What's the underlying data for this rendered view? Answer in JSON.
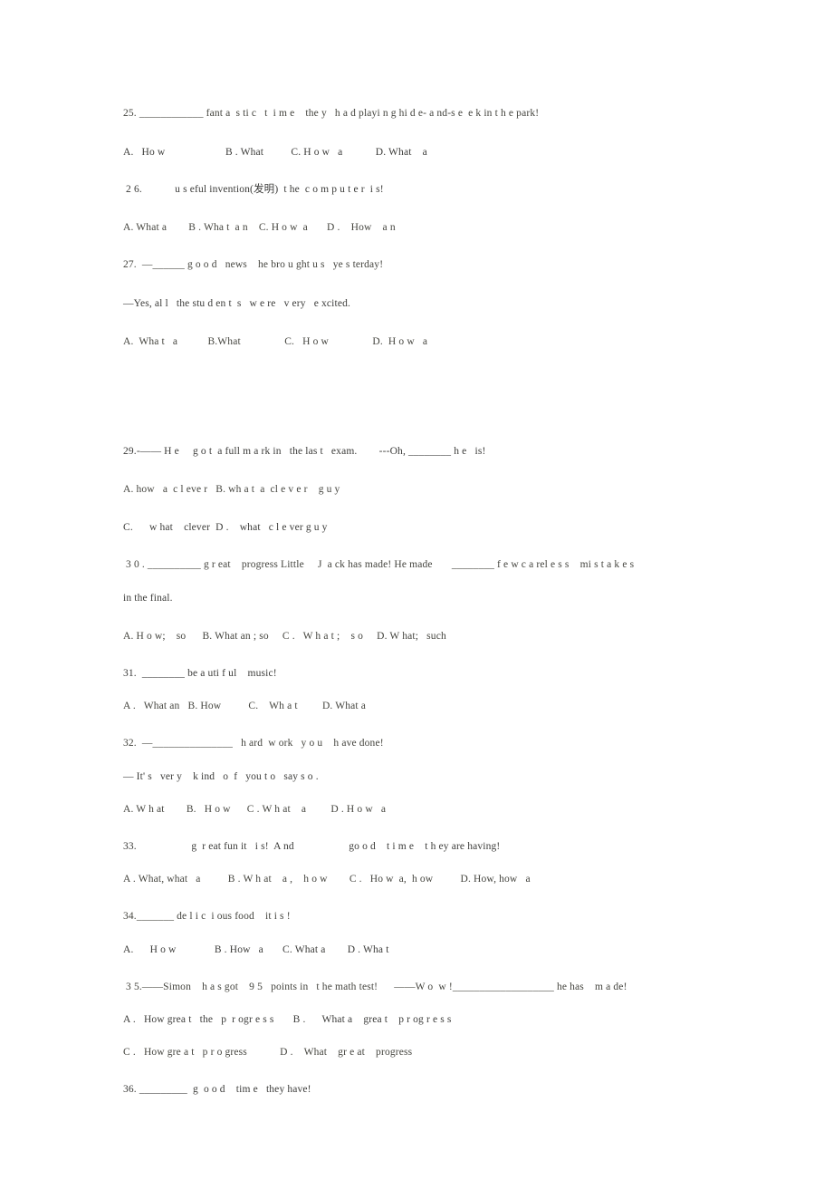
{
  "document": {
    "kind": "scanned-worksheet",
    "background_color": "#ffffff",
    "text_color": "#41413f"
  },
  "questions": [
    {
      "number": "25.",
      "stem": "25. ____________ fant a  s ti c   t  i m e    the y   h a d playi n g hi d e- a nd-s e  e k in t h e park!",
      "options": "A.   Ho w                      B . What          C. H o w   a            D. What    a",
      "continuation": null
    },
    {
      "number": "26.",
      "stem": " 2 6.            u s eful invention(发明)  t he  c o m p u t e r  i s!",
      "options": "A. What a        B . Wha t  a n    C. H o w  a       D .    How    a n",
      "continuation": null
    },
    {
      "number": "27.",
      "stem": "27.  —______ g o o d   news    he bro u ght u s   ye s terday!",
      "options": "A.  Wha t   a           B.What                C.   H o w                D.  H o w   a",
      "continuation": "—Yes, al l   the stu d en t  s   w e re   v ery   e xcited."
    },
    {
      "number": "29.",
      "stem": "29.-—— H e     g o t  a full m a rk in   the las t   exam.        ---Oh, ________ h e   is!",
      "options": "A. how   a  c l eve r   B. wh a t  a  cl e v e r    g u y",
      "options2": "C.      w hat    clever  D .    what   c l e ver g u y",
      "continuation": null
    },
    {
      "number": "30.",
      "stem": " 3 0 . __________ g r eat    progress Little     J  a ck has made! He made       ________ f e w c a rel e s s    mi s t a k e s",
      "options": "A. H o w;    so      B. What an ; so     C .   W h a t ;    s o     D. W hat;   such",
      "continuation": "in the final."
    },
    {
      "number": "31.",
      "stem": "31.  ________ be a uti f ul    music!",
      "options": "A .   What an   B. How          C.    Wh a t         D. What a",
      "continuation": null
    },
    {
      "number": "32.",
      "stem": "32.  —_______________   h ard  w ork   y o u    h ave done!",
      "options": "A. W h at        B.   H o w      C . W h at    a         D . H o w   a",
      "continuation": "— It' s   ver y    k ind   o  f   you t o   say s o ."
    },
    {
      "number": "33.",
      "stem": "33.                    g  r eat fun it   i s!  A nd                    go o d    t i m e    t h ey are having!",
      "options": "A . What, what   a          B . W h at    a ,    h o w        C .   Ho w  a,  h ow          D. How, how   a",
      "continuation": null
    },
    {
      "number": "34.",
      "stem": "34._______ de l i c  i ous food    it i s !",
      "options": "A.      H o w              B . How   a       C. What a        D . Wha t",
      "continuation": null
    },
    {
      "number": "35.",
      "stem": " 3 5.——Simon    h a s got    9 5   points in   t he math test!      ——W o  w !___________________ he has    m a de!",
      "options": "A .   How grea t   the   p  r ogr e s s       B .      What a    grea t    p r og r e s s",
      "options2": "C .   How gre a t   p r o gress            D .    What    gr e at    progress",
      "continuation": null
    },
    {
      "number": "36.",
      "stem": "36. _________  g  o o d    tim e   they have!",
      "options": null,
      "continuation": null
    }
  ]
}
